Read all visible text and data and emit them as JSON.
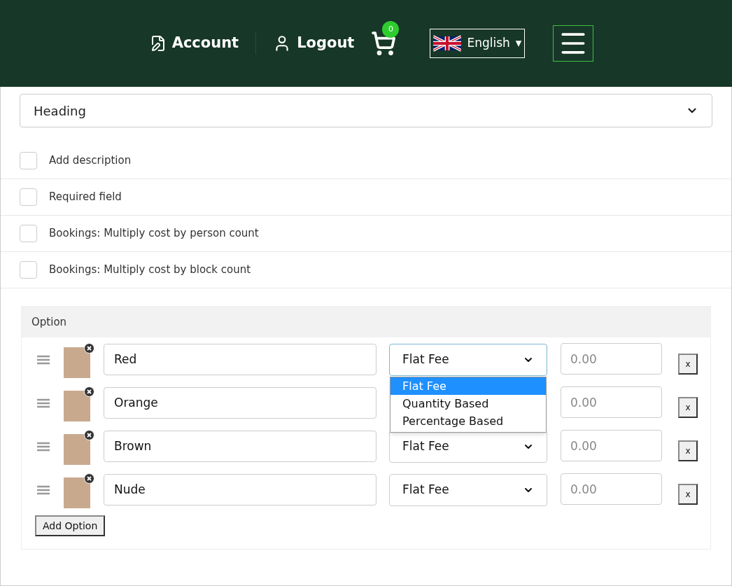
{
  "header": {
    "account": "Account",
    "logout": "Logout",
    "cart_count": "0",
    "language": "English",
    "language_caret": "▾"
  },
  "field_type": {
    "value": "Heading"
  },
  "settings": [
    {
      "label": "Add description",
      "checked": false
    },
    {
      "label": "Required field",
      "checked": false
    },
    {
      "label": "Bookings: Multiply cost by person count",
      "checked": false
    },
    {
      "label": "Bookings: Multiply cost by block count",
      "checked": false
    }
  ],
  "options_panel": {
    "title": "Option",
    "rows": [
      {
        "name": "Red",
        "fee_type": "Flat Fee",
        "price_placeholder": "0.00",
        "remove": "x",
        "dropdown": [
          {
            "label": "Flat Fee",
            "selected": true
          },
          {
            "label": "Quantity Based",
            "selected": false
          },
          {
            "label": "Percentage Based",
            "selected": false
          }
        ]
      },
      {
        "name": "Orange",
        "price_placeholder": "0.00",
        "remove": "x"
      },
      {
        "name": "Brown",
        "fee_type": "Flat Fee",
        "price_placeholder": "0.00",
        "remove": "x"
      },
      {
        "name": "Nude",
        "fee_type": "Flat Fee",
        "price_placeholder": "0.00",
        "remove": "x"
      }
    ],
    "add_button": "Add Option"
  }
}
